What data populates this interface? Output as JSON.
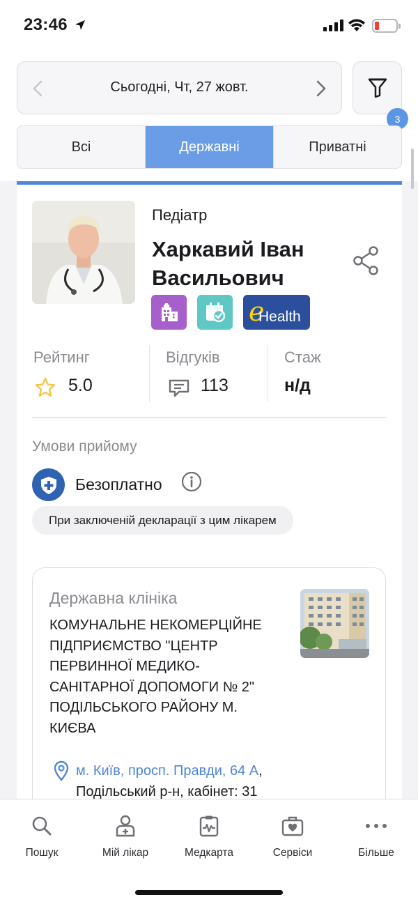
{
  "status_bar": {
    "time": "23:46"
  },
  "date_nav": {
    "label": "Сьогодні, Чт, 27 жовт."
  },
  "filter": {
    "badge_count": "3"
  },
  "segments": [
    {
      "label": "Всі",
      "active": false
    },
    {
      "label": "Державні",
      "active": true
    },
    {
      "label": "Приватні",
      "active": false
    }
  ],
  "doctor": {
    "specialty": "Педіатр",
    "name": "Харкавий Іван Васильович",
    "badges": [
      "clinic-building-icon",
      "calendar-check-icon",
      "ehealth-logo"
    ],
    "ehealth_text": "Health"
  },
  "stats": {
    "rating_caption": "Рейтинг",
    "rating_value": "5.0",
    "reviews_caption": "Відгуків",
    "reviews_value": "113",
    "experience_caption": "Стаж",
    "experience_value": "н/д"
  },
  "conditions": {
    "title": "Умови прийому",
    "payment": "Безоплатно",
    "note": "При заключеній декларації з цим лікарем"
  },
  "clinic": {
    "type": "Державна клініка",
    "name": "КОМУНАЛЬНЕ НЕКОМЕРЦІЙНЕ ПІДПРИЄМСТВО \"ЦЕНТР ПЕРВИННОЇ МЕДИКО-САНІТАРНОЇ ДОПОМОГИ № 2\" ПОДІЛЬСЬКОГО РАЙОНУ М. КИЄВА",
    "address_link": "м. Київ, просп. Правди, 64 А",
    "address_rest": "Подільський р-н, кабінет: 31"
  },
  "tabs": [
    {
      "label": "Пошук",
      "icon": "search-icon"
    },
    {
      "label": "Мій лікар",
      "icon": "doctor-icon"
    },
    {
      "label": "Медкарта",
      "icon": "medical-card-icon"
    },
    {
      "label": "Сервіси",
      "icon": "services-kit-icon"
    },
    {
      "label": "Більше",
      "icon": "more-dots-icon"
    }
  ],
  "colors": {
    "accent": "#4f86d6",
    "segment_active": "#6a9de5",
    "badge_purple": "#a65fcb",
    "badge_teal": "#5fc7c4",
    "ehealth_blue": "#2c4f9d",
    "shield_blue": "#2e63b3",
    "star": "#f5c542"
  }
}
